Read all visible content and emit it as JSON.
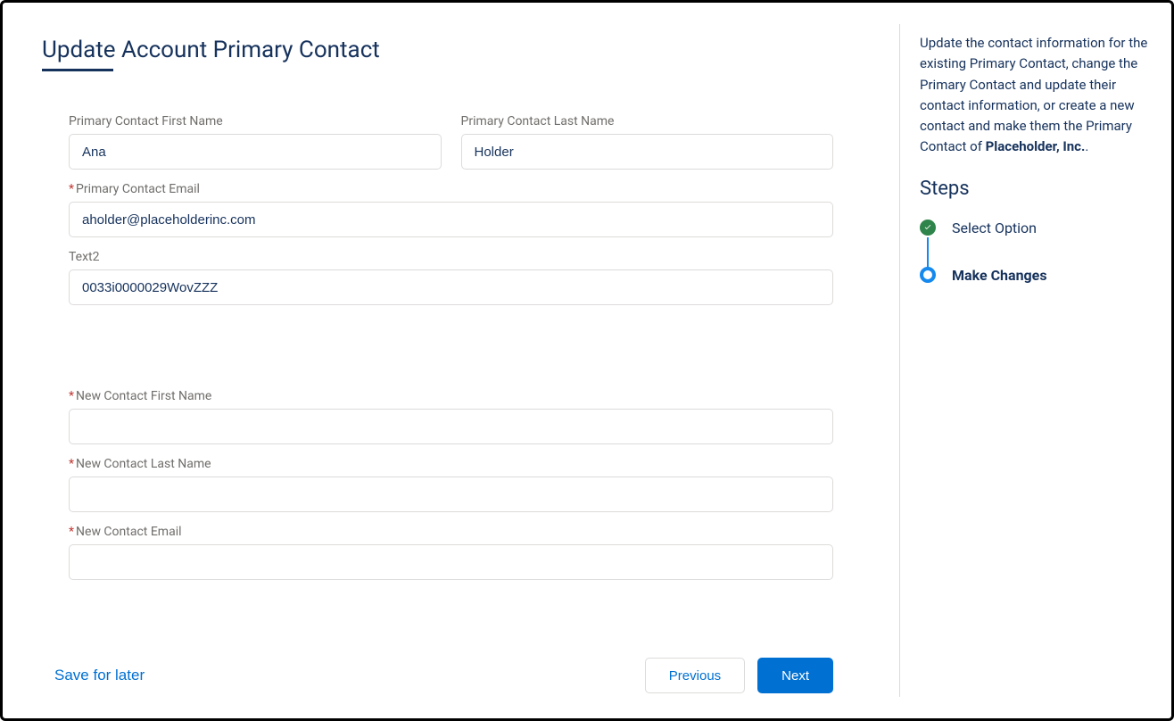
{
  "header": {
    "title": "Update Account Primary Contact"
  },
  "form": {
    "primary_first_name": {
      "label": "Primary Contact First Name",
      "value": "Ana",
      "required": false
    },
    "primary_last_name": {
      "label": "Primary Contact Last Name",
      "value": "Holder",
      "required": false
    },
    "primary_email": {
      "label": "Primary Contact Email",
      "value": "aholder@placeholderinc.com",
      "required": true
    },
    "text2": {
      "label": "Text2",
      "value": "0033i0000029WovZZZ",
      "required": false
    },
    "new_first_name": {
      "label": "New Contact First Name",
      "value": "",
      "required": true
    },
    "new_last_name": {
      "label": "New Contact Last Name",
      "value": "",
      "required": true
    },
    "new_email": {
      "label": "New Contact Email",
      "value": "",
      "required": true
    }
  },
  "footer": {
    "save_for_later": "Save for later",
    "previous": "Previous",
    "next": "Next"
  },
  "sidebar": {
    "description_prefix": "Update the contact information for the existing Primary Contact, change the Primary Contact and update their contact information, or create a new contact and make them the Primary Contact of ",
    "description_bold": "Placeholder, Inc.",
    "description_suffix": ".",
    "steps_heading": "Steps",
    "steps": [
      {
        "label": "Select Option",
        "state": "done"
      },
      {
        "label": "Make Changes",
        "state": "current"
      }
    ]
  }
}
